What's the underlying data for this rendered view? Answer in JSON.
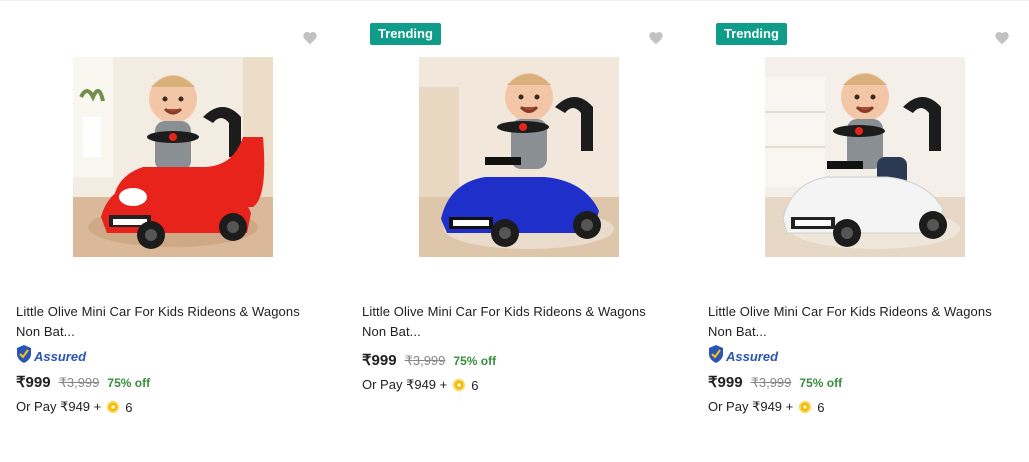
{
  "products": [
    {
      "trending": false,
      "badge": "",
      "title_line1": "Little Olive Mini Car For Kids Rideons & Wagons",
      "title_line2": "Non Bat...",
      "assured": true,
      "assured_label": "Assured",
      "price": "₹999",
      "mrp": "₹3,999",
      "discount": "75% off",
      "pay_prefix": "Or Pay ₹949 +",
      "coins": "6",
      "car_color": "#e8231b",
      "image_alt": "car-red"
    },
    {
      "trending": true,
      "badge": "Trending",
      "title_line1": "Little Olive Mini Car For Kids Rideons & Wagons",
      "title_line2": "Non Bat...",
      "assured": false,
      "assured_label": "",
      "price": "₹999",
      "mrp": "₹3,999",
      "discount": "75% off",
      "pay_prefix": "Or Pay ₹949 +",
      "coins": "6",
      "car_color": "#1f2fc9",
      "image_alt": "car-blue"
    },
    {
      "trending": true,
      "badge": "Trending",
      "title_line1": "Little Olive Mini Car For Kids Rideons & Wagons",
      "title_line2": "Non Bat...",
      "assured": true,
      "assured_label": "Assured",
      "price": "₹999",
      "mrp": "₹3,999",
      "discount": "75% off",
      "pay_prefix": "Or Pay ₹949 +",
      "coins": "6",
      "car_color": "#f4f4f4",
      "image_alt": "car-white"
    }
  ],
  "colors": {
    "trending_badge": "#0f9d8a",
    "discount": "#388e3c",
    "assured": "#2a55b4",
    "mrp": "#878787",
    "coin": "#f5b400",
    "wishlist": "#c2c2c2"
  },
  "icons": {
    "wishlist": "heart-icon",
    "assured": "assured-shield-icon",
    "coin": "supercoin-icon"
  }
}
